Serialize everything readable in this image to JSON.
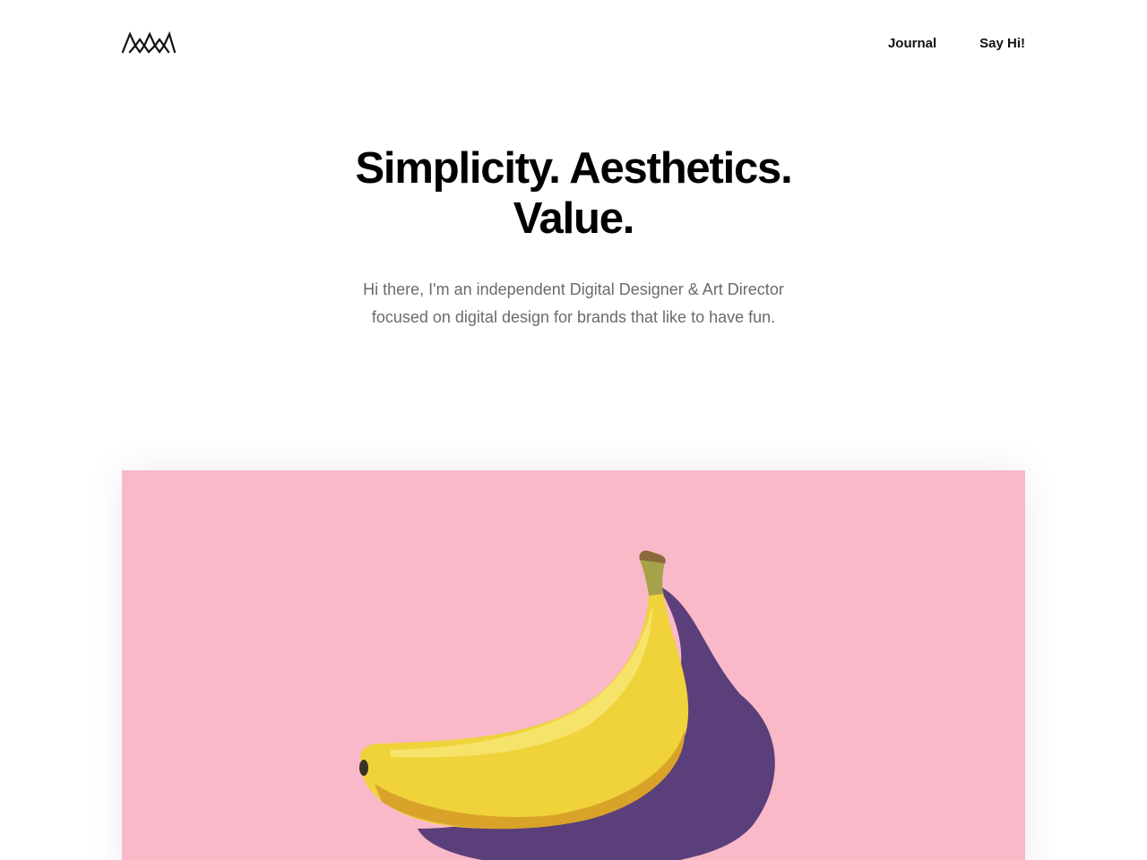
{
  "header": {
    "logo_icon": "zigzag-mountain-logo-icon",
    "nav": [
      {
        "label": "Journal"
      },
      {
        "label": "Say Hi!"
      }
    ]
  },
  "hero": {
    "title_line1": "Simplicity. Aesthetics.",
    "title_line2": "Value.",
    "intro": "Hi there, I'm an independent Digital Designer & Art Director focused on digital design for brands that like to have fun."
  },
  "feature": {
    "image_subject": "banana-on-pink-background",
    "background_color": "#f9b9c8",
    "shadow_color": "#5b3f7a",
    "banana_color": "#f0d23a"
  }
}
